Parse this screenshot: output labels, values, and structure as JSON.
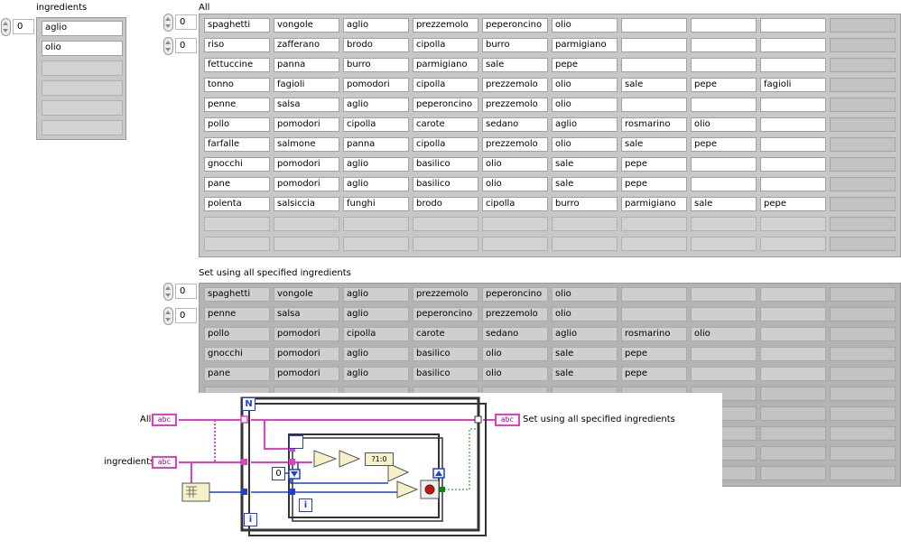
{
  "ingredients": {
    "label": "ingredients",
    "index": "0",
    "items": [
      "aglio",
      "olio",
      "",
      "",
      "",
      ""
    ]
  },
  "all": {
    "label": "All",
    "row_index": "0",
    "col_index": "0",
    "rows": [
      [
        "spaghetti",
        "vongole",
        "aglio",
        "prezzemolo",
        "peperoncino",
        "olio",
        "",
        "",
        ""
      ],
      [
        "riso",
        "zafferano",
        "brodo",
        "cipolla",
        "burro",
        "parmigiano",
        "",
        "",
        ""
      ],
      [
        "fettuccine",
        "panna",
        "burro",
        "parmigiano",
        "sale",
        "pepe",
        "",
        "",
        ""
      ],
      [
        "tonno",
        "fagioli",
        "pomodori",
        "cipolla",
        "prezzemolo",
        "olio",
        "sale",
        "pepe",
        "fagioli"
      ],
      [
        "penne",
        "salsa",
        "aglio",
        "peperoncino",
        "prezzemolo",
        "olio",
        "",
        "",
        ""
      ],
      [
        "pollo",
        "pomodori",
        "cipolla",
        "carote",
        "sedano",
        "aglio",
        "rosmarino",
        "olio",
        ""
      ],
      [
        "farfalle",
        "salmone",
        "panna",
        "cipolla",
        "prezzemolo",
        "olio",
        "sale",
        "pepe",
        ""
      ],
      [
        "gnocchi",
        "pomodori",
        "aglio",
        "basilico",
        "olio",
        "sale",
        "pepe",
        "",
        ""
      ],
      [
        "pane",
        "pomodori",
        "aglio",
        "basilico",
        "olio",
        "sale",
        "pepe",
        "",
        ""
      ],
      [
        "polenta",
        "salsiccia",
        "funghi",
        "brodo",
        "cipolla",
        "burro",
        "parmigiano",
        "sale",
        "pepe"
      ]
    ]
  },
  "result": {
    "label": "Set using all specified ingredients",
    "row_index": "0",
    "col_index": "0",
    "rows": [
      [
        "spaghetti",
        "vongole",
        "aglio",
        "prezzemolo",
        "peperoncino",
        "olio",
        "",
        "",
        ""
      ],
      [
        "penne",
        "salsa",
        "aglio",
        "peperoncino",
        "prezzemolo",
        "olio",
        "",
        "",
        ""
      ],
      [
        "pollo",
        "pomodori",
        "cipolla",
        "carote",
        "sedano",
        "aglio",
        "rosmarino",
        "olio",
        ""
      ],
      [
        "gnocchi",
        "pomodori",
        "aglio",
        "basilico",
        "olio",
        "sale",
        "pepe",
        "",
        ""
      ],
      [
        "pane",
        "pomodori",
        "aglio",
        "basilico",
        "olio",
        "sale",
        "pepe",
        "",
        ""
      ]
    ]
  },
  "diagram": {
    "all_label": "All",
    "ingredients_label": "ingredients",
    "output_label": "Set using all specified ingredients",
    "str_tag": "abc",
    "loop_count": "N",
    "loop_index": "i",
    "inner_index": "i",
    "const_zero": "0",
    "match_tag": "?1:0"
  },
  "colors": {
    "string_wire": "#e040c8",
    "numeric_wire": "#1d3fd6",
    "boolean_wire": "#0a8a0a",
    "structure_border": "#333333"
  }
}
